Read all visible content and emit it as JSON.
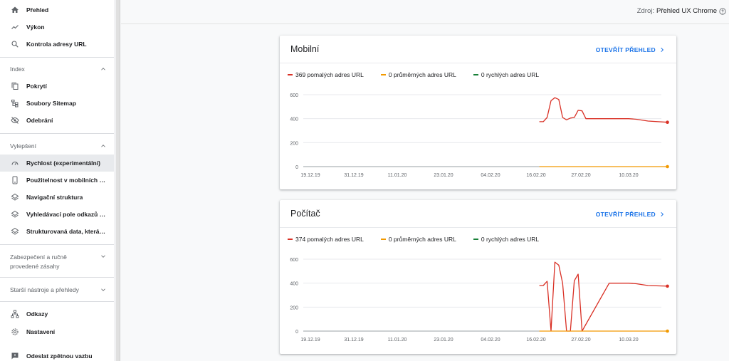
{
  "sidebar": {
    "top_items": [
      {
        "label": "Přehled",
        "icon": "home-icon"
      },
      {
        "label": "Výkon",
        "icon": "trending-icon"
      },
      {
        "label": "Kontrola adresy URL",
        "icon": "search-icon"
      }
    ],
    "index_section": {
      "title": "Index",
      "items": [
        {
          "label": "Pokrytí",
          "icon": "copy-icon"
        },
        {
          "label": "Soubory Sitemap",
          "icon": "sitemap-icon"
        },
        {
          "label": "Odebrání",
          "icon": "eye-off-icon"
        }
      ]
    },
    "enhance_section": {
      "title": "Vylepšení",
      "items": [
        {
          "label": "Rychlost (experimentální)",
          "icon": "speed-icon"
        },
        {
          "label": "Použitelnost v mobilních zaří...",
          "icon": "phone-icon"
        },
        {
          "label": "Navigační struktura",
          "icon": "layers-icon"
        },
        {
          "label": "Vyhledávací pole odkazů na ...",
          "icon": "layers-icon"
        },
        {
          "label": "Strukturovaná data, která nel...",
          "icon": "layers-icon"
        }
      ]
    },
    "security_section": {
      "title_line1": "Zabezpečení a ručně",
      "title_line2": "provedené zásahy"
    },
    "legacy_section": {
      "title": "Starší nástroje a přehledy"
    },
    "bottom_items": [
      {
        "label": "Odkazy",
        "icon": "links-icon"
      },
      {
        "label": "Nastavení",
        "icon": "gear-icon"
      },
      {
        "label": "Odeslat zpětnou vazbu",
        "icon": "feedback-icon"
      }
    ]
  },
  "topbar": {
    "source_label": "Zdroj:",
    "source_value": "Přehled UX Chrome"
  },
  "cards": [
    {
      "title": "Mobilní",
      "link_label": "OTEVŘÍT PŘEHLED",
      "legend": [
        {
          "label": "369 pomalých adres URL",
          "color": "#d93025"
        },
        {
          "label": "0 průměrných adres URL",
          "color": "#f29900"
        },
        {
          "label": "0 rychlých adres URL",
          "color": "#188038"
        }
      ]
    },
    {
      "title": "Počítač",
      "link_label": "OTEVŘÍT PŘEHLED",
      "legend": [
        {
          "label": "374 pomalých adres URL",
          "color": "#d93025"
        },
        {
          "label": "0 průměrných adres URL",
          "color": "#f29900"
        },
        {
          "label": "0 rychlých adres URL",
          "color": "#188038"
        }
      ]
    }
  ],
  "chart_data": [
    {
      "type": "line",
      "x_ticks": [
        "19.12.19",
        "31.12.19",
        "11.01.20",
        "23.01.20",
        "04.02.20",
        "16.02.20",
        "27.02.20",
        "10.03.20"
      ],
      "y_ticks": [
        "0",
        "200",
        "400",
        "600"
      ],
      "ylim": [
        0,
        600
      ],
      "series": [
        {
          "name": "369 pomalých adres URL",
          "color": "#d93025",
          "x": [
            "2020-02-16",
            "2020-02-17",
            "2020-02-18",
            "2020-02-19",
            "2020-02-20",
            "2020-02-21",
            "2020-02-22",
            "2020-02-23",
            "2020-02-24",
            "2020-02-25",
            "2020-02-26",
            "2020-02-27",
            "2020-02-28",
            "2020-03-01",
            "2020-03-05",
            "2020-03-10",
            "2020-03-12",
            "2020-03-15",
            "2020-03-20"
          ],
          "y": [
            375,
            375,
            410,
            550,
            575,
            560,
            410,
            390,
            405,
            410,
            470,
            465,
            400,
            400,
            400,
            400,
            395,
            380,
            370
          ]
        },
        {
          "name": "0 průměrných adres URL",
          "color": "#f29900",
          "x": [
            "2020-02-16",
            "2020-03-20"
          ],
          "y": [
            0,
            0
          ]
        }
      ]
    },
    {
      "type": "line",
      "x_ticks": [
        "19.12.19",
        "31.12.19",
        "11.01.20",
        "23.01.20",
        "04.02.20",
        "16.02.20",
        "27.02.20",
        "10.03.20"
      ],
      "y_ticks": [
        "0",
        "200",
        "400",
        "600"
      ],
      "ylim": [
        0,
        600
      ],
      "series": [
        {
          "name": "374 pomalých adres URL",
          "color": "#d93025",
          "x": [
            "2020-02-16",
            "2020-02-17",
            "2020-02-18",
            "2020-02-19",
            "2020-02-20",
            "2020-02-21",
            "2020-02-22",
            "2020-02-23",
            "2020-02-24",
            "2020-02-25",
            "2020-02-26",
            "2020-02-27",
            "2020-03-05",
            "2020-03-10",
            "2020-03-12",
            "2020-03-15",
            "2020-03-20"
          ],
          "y": [
            380,
            380,
            415,
            0,
            575,
            550,
            400,
            0,
            0,
            420,
            475,
            0,
            400,
            400,
            395,
            380,
            375
          ]
        },
        {
          "name": "0 průměrných adres URL",
          "color": "#f29900",
          "x": [
            "2020-02-16",
            "2020-03-20"
          ],
          "y": [
            0,
            0
          ]
        }
      ]
    }
  ]
}
